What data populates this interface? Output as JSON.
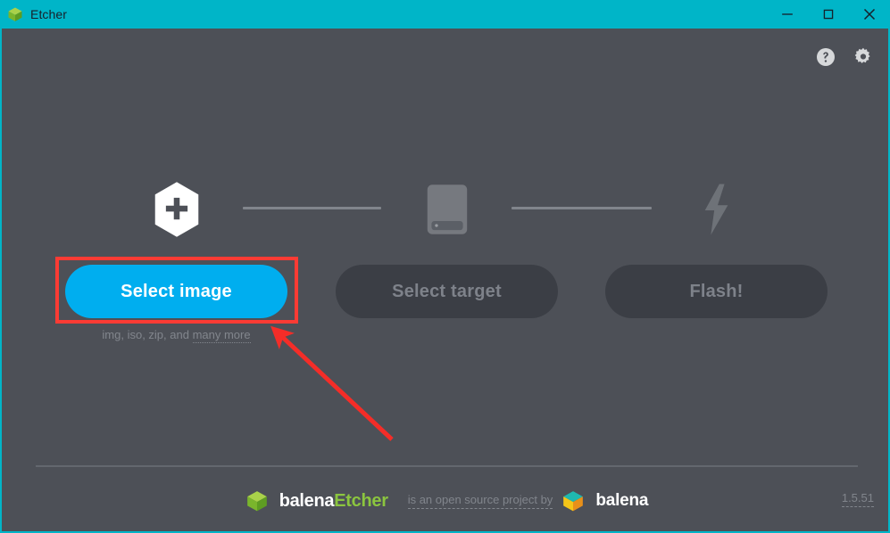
{
  "window": {
    "title": "Etcher",
    "title_icon": "etcher-cube-icon",
    "accent_color": "#00b5c8",
    "background_color": "#4d5057",
    "controls": {
      "minimize": "minimize-icon",
      "maximize": "maximize-icon",
      "close": "close-icon"
    }
  },
  "header": {
    "help_icon": "help-circle-icon",
    "settings_icon": "gear-icon"
  },
  "steps": [
    {
      "icon": "hexagon-plus-icon",
      "button_label": "Select image",
      "state": "enabled",
      "hint": "img, iso, zip, and many more",
      "hint_underlined": "many more"
    },
    {
      "icon": "drive-icon",
      "button_label": "Select target",
      "state": "disabled",
      "hint": "",
      "hint_underlined": ""
    },
    {
      "icon": "lightning-bolt-icon",
      "button_label": "Flash!",
      "state": "disabled",
      "hint": "",
      "hint_underlined": ""
    }
  ],
  "buttons": {
    "select_image": "Select image",
    "select_target": "Select target",
    "flash": "Flash!",
    "primary_color": "#00aeef",
    "disabled_color": "#3b3e45"
  },
  "hint": {
    "prefix": "img, iso, zip, and ",
    "underlined": "many more"
  },
  "footer": {
    "etcher_logo_icon": "balena-etcher-cube-icon",
    "etcher_brand_first": "balena",
    "etcher_brand_second": "Etcher",
    "tagline": "is an open source project by",
    "balena_logo_icon": "balena-cube-icon",
    "balena_brand": "balena",
    "version": "1.5.51",
    "etcher_green": "#8bc53f"
  },
  "annotations": {
    "highlight_color": "#fc3b34",
    "box_target": "select-image-button",
    "arrow_points_to": "select-image-button"
  }
}
